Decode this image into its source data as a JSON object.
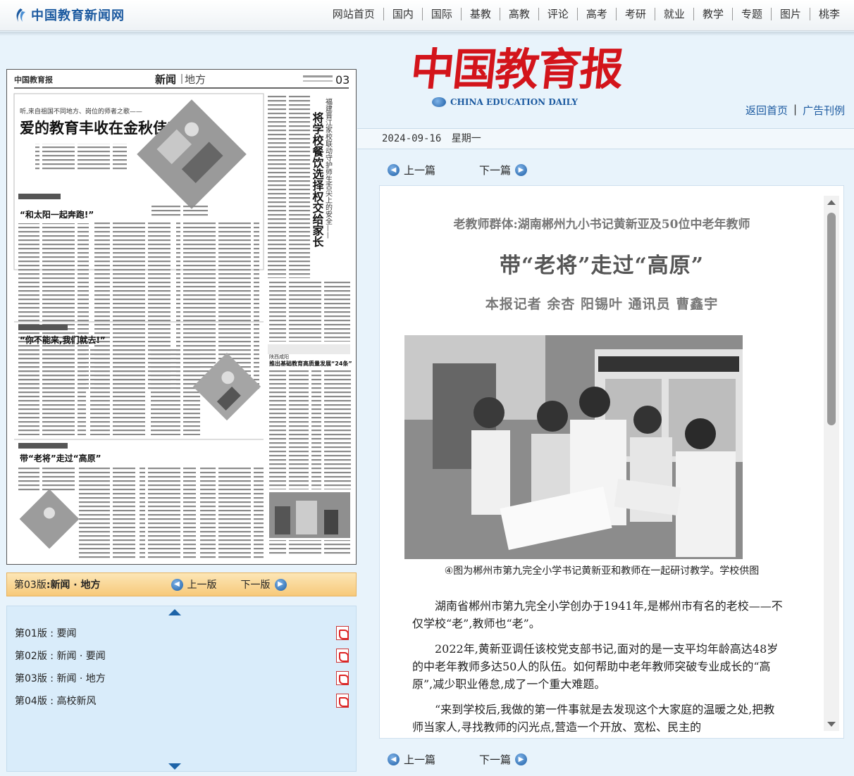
{
  "site": {
    "logo_text": "中国教育新闻网",
    "nav": [
      "网站首页",
      "国内",
      "国际",
      "基教",
      "高教",
      "评论",
      "高考",
      "考研",
      "就业",
      "教学",
      "专题",
      "图片",
      "桃李"
    ]
  },
  "masthead": {
    "cn": "中国教育报",
    "en": "CHINA EDUCATION DAILY",
    "links": [
      "返回首页",
      "广告刊例"
    ],
    "date": "2024-09-16",
    "weekday": "星期一"
  },
  "pager": {
    "prev": "上一篇",
    "next": "下一篇"
  },
  "page_thumb": {
    "paper_name": "中国教育报",
    "section": "新闻",
    "subsection": "地方",
    "page_no": "03",
    "lead_kicker": "听,来自祖国不同地方、岗位的师者之歌——",
    "lead_title": "爱的教育丰收在金秋佳节",
    "story1_title": "“和太阳一起奔跑!”",
    "story2_title": "“你不能来,我们就去!”",
    "story3_title": "带“老将”走过“高原”",
    "side_vertical_title": "将学校餐饮选择权交给家长",
    "side_vertical_kicker": "福建晋江家校联动守护师生舌尖上的安全——",
    "side_small_kicker": "陕西咸阳",
    "side_small_title": "推出基础教育高质量发展“24条”"
  },
  "version_bar": {
    "label": "第03版",
    "name": "新闻 · 地方",
    "prev": "上一版",
    "next": "下一版"
  },
  "editions": [
    {
      "no": "第01版",
      "name": "要闻"
    },
    {
      "no": "第02版",
      "name": "新闻 · 要闻"
    },
    {
      "no": "第03版",
      "name": "新闻 · 地方"
    },
    {
      "no": "第04版",
      "name": "高校新风"
    }
  ],
  "article": {
    "kicker": "老教师群体:湖南郴州九小书记黄新亚及50位中老年教师",
    "headline": "带“老将”走过“高原”",
    "byline": "本报记者  余杏  阳锡叶  通讯员  曹鑫宇",
    "caption": "④图为郴州市第九完全小学书记黄新亚和教师在一起研讨教学。学校供图",
    "paragraphs": [
      "湖南省郴州市第九完全小学创办于1941年,是郴州市有名的老校——不仅学校“老”,教师也“老”。",
      "2022年,黄新亚调任该校党支部书记,面对的是一支平均年龄高达48岁的中老年教师多达50人的队伍。如何帮助中老年教师突破专业成长的“高原”,减少职业倦怠,成了一个重大难题。",
      "“来到学校后,我做的第一件事就是去发现这个大家庭的温暖之处,把教师当家人,寻找教师的闪光点,营造一个开放、宽松、民主的"
    ]
  },
  "colors": {
    "brand_blue": "#1c5aa0",
    "mast_red": "#d3141b",
    "version_bar": "#f7c97a"
  }
}
